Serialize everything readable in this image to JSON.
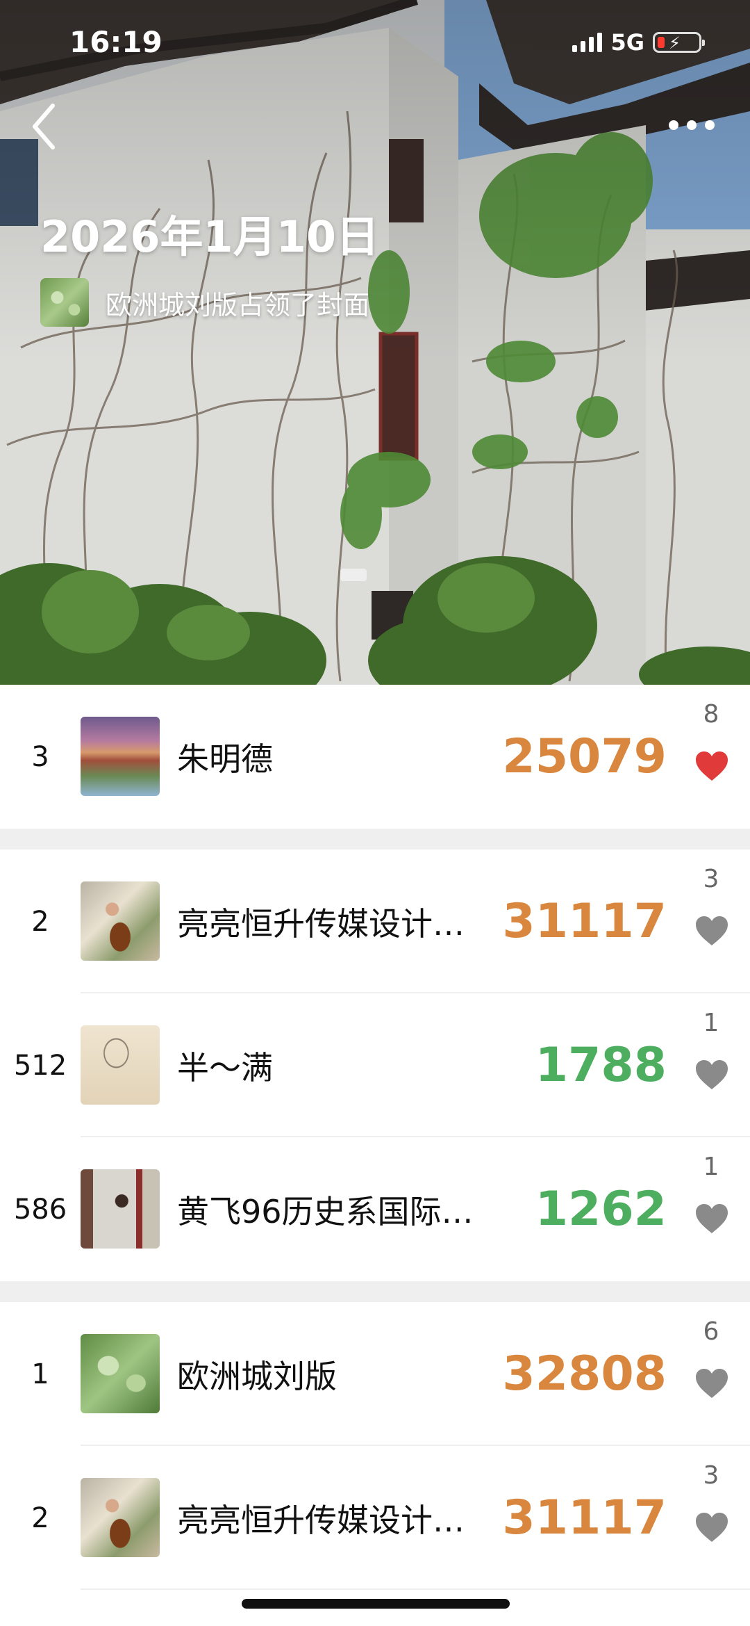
{
  "status_bar": {
    "time": "16:19",
    "network": "5G",
    "battery_level": "low",
    "charging": true
  },
  "header": {
    "back_icon": "chevron-left-icon",
    "more_icon": "more-dots-icon"
  },
  "cover": {
    "date": "2026年1月10日",
    "owner_text": "欧洲城刘版占领了封面"
  },
  "sections": [
    {
      "rows": [
        {
          "rank": "3",
          "name": "朱明德",
          "steps": "25079",
          "steps_color": "#d9873e",
          "likes": "8",
          "liked": true
        }
      ]
    },
    {
      "rows": [
        {
          "rank": "2",
          "name": "亮亮恒升传媒设计…",
          "steps": "31117",
          "steps_color": "#d9873e",
          "likes": "3",
          "liked": false
        },
        {
          "rank": "512",
          "name": "半～满",
          "steps": "1788",
          "steps_color": "#4cae5e",
          "likes": "1",
          "liked": false
        },
        {
          "rank": "586",
          "name": "黄飞96历史系国际…",
          "steps": "1262",
          "steps_color": "#4cae5e",
          "likes": "1",
          "liked": false
        }
      ]
    },
    {
      "rows": [
        {
          "rank": "1",
          "name": "欧洲城刘版",
          "steps": "32808",
          "steps_color": "#d9873e",
          "likes": "6",
          "liked": false
        },
        {
          "rank": "2",
          "name": "亮亮恒升传媒设计…",
          "steps": "31117",
          "steps_color": "#d9873e",
          "likes": "3",
          "liked": false
        }
      ]
    }
  ],
  "colors": {
    "steps_high": "#d9873e",
    "steps_low": "#4cae5e",
    "heart_active": "#e03a3a",
    "heart_inactive": "#8a8a8a"
  }
}
